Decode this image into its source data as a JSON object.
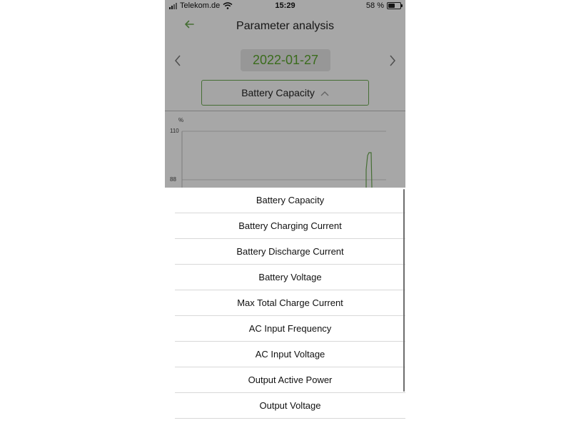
{
  "status_bar": {
    "carrier": "Telekom.de",
    "time": "15:29",
    "battery_percent": "58 %",
    "battery_level": 0.58
  },
  "header": {
    "title": "Parameter analysis",
    "back_icon": "back-arrow-icon"
  },
  "date_nav": {
    "date": "2022-01-27",
    "prev_icon": "chevron-left-icon",
    "next_icon": "chevron-right-icon"
  },
  "parameter_selector": {
    "selected": "Battery Capacity",
    "caret_icon": "chevron-up-icon"
  },
  "chart": {
    "unit": "%",
    "ticks": [
      "110",
      "88"
    ]
  },
  "chart_data": {
    "type": "line",
    "ylabel": "%",
    "y_ticks": [
      110,
      88
    ],
    "line_color": "#6aa84f",
    "series": [
      {
        "values": []
      }
    ]
  },
  "picker": {
    "items": [
      "Battery Capacity",
      "Battery Charging Current",
      "Battery Discharge Current",
      "Battery Voltage",
      "Max Total Charge Current",
      "AC Input Frequency",
      "AC Input Voltage",
      "Output Active Power",
      "Output Voltage"
    ]
  },
  "colors": {
    "accent": "#5aa52c",
    "border_green": "#6aa84f",
    "overlay": "rgba(0,0,0,0.34)"
  }
}
